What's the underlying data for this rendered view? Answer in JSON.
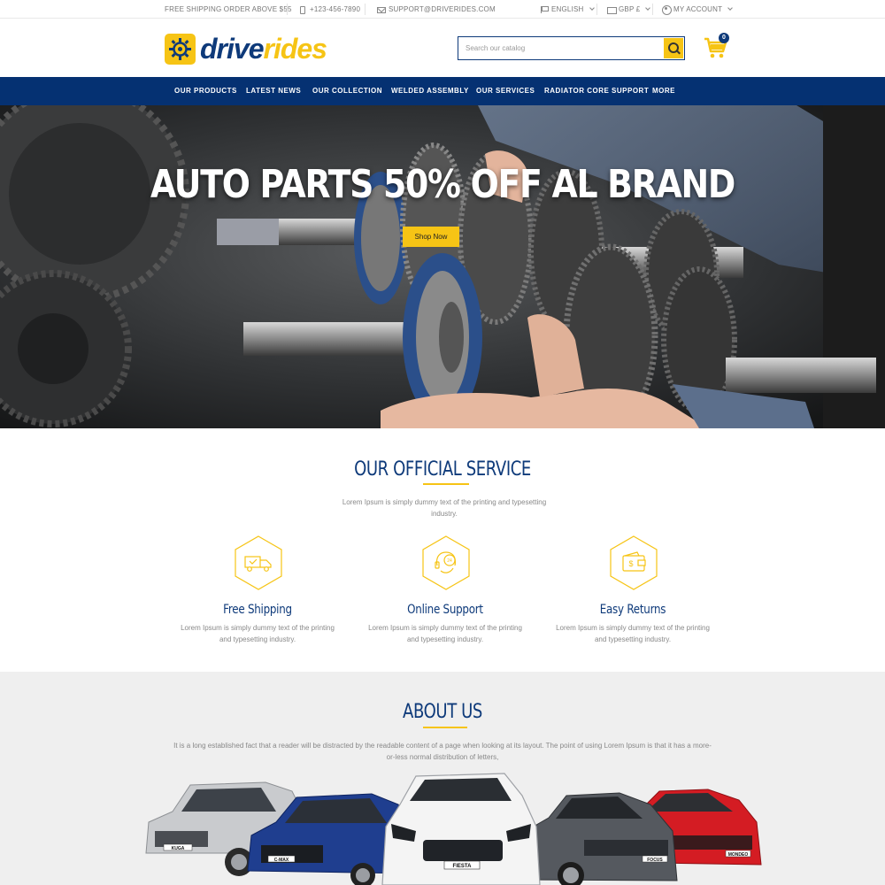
{
  "topbar": {
    "shipping": "FREE SHIPPING ORDER ABOVE $55",
    "phone": "+123-456-7890",
    "email": "SUPPORT@DRIVERIDES.COM",
    "language": "ENGLISH",
    "currency": "GBP £",
    "account": "MY ACCOUNT"
  },
  "header": {
    "logo_part1": "drive",
    "logo_part2": "rides",
    "search_placeholder": "Search our catalog",
    "cart_count": "0"
  },
  "nav": {
    "items": [
      "OUR PRODUCTS",
      "LATEST NEWS",
      "OUR COLLECTION",
      "WELDED ASSEMBLY",
      "OUR SERVICES",
      "RADIATOR CORE SUPPORT",
      "MORE"
    ]
  },
  "hero": {
    "title": "AUTO PARTS 50% OFF AL BRAND",
    "button": "Shop Now"
  },
  "services": {
    "title": "OUR OFFICIAL SERVICE",
    "subtitle_line1": "Lorem Ipsum is simply dummy text of the printing and typesetting",
    "subtitle_line2": "industry.",
    "items": [
      {
        "title": "Free Shipping",
        "text_line1": "Lorem Ipsum is simply dummy text of the printing",
        "text_line2": "and typesetting industry.",
        "icon": "truck-icon"
      },
      {
        "title": "Online Support",
        "text_line1": "Lorem Ipsum is simply dummy text of the printing",
        "text_line2": "and typesetting industry.",
        "icon": "headset-24-icon"
      },
      {
        "title": "Easy Returns",
        "text_line1": "Lorem Ipsum is simply dummy text of the printing",
        "text_line2": "and typesetting industry.",
        "icon": "wallet-dollar-icon"
      }
    ]
  },
  "about": {
    "title": "ABOUT US",
    "text_line1": "It is a long established fact that a reader will be distracted by the readable content of a page when looking at its layout. The point of using Lorem Ipsum is that it has a more-",
    "text_line2": "or-less normal distribution of letters,",
    "car_plates": [
      "KUGA",
      "C-MAX",
      "FIESTA",
      "FOCUS",
      "MONDEO"
    ]
  },
  "colors": {
    "brand_blue": "#0e3a7a",
    "nav_blue": "#053172",
    "accent_yellow": "#f6c415"
  }
}
